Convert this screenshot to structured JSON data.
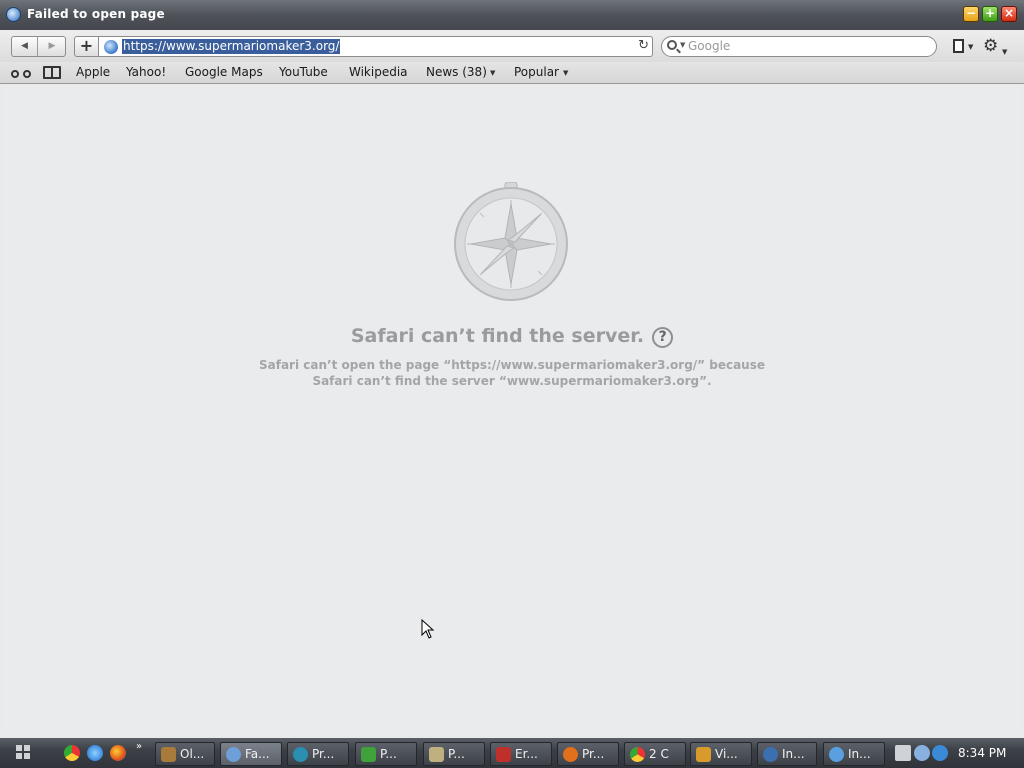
{
  "window": {
    "title": "Failed to open page"
  },
  "toolbar": {
    "back": "◀",
    "forward": "▶",
    "add_bookmark": "+",
    "url": "https://www.supermariomaker3.org/",
    "reload": "↻",
    "search_placeholder": "Google"
  },
  "bookmarks": [
    "Apple",
    "Yahoo!",
    "Google Maps",
    "YouTube",
    "Wikipedia",
    "News (38)",
    "Popular"
  ],
  "error": {
    "heading": "Safari can’t find the server.",
    "help": "?",
    "body_line1": "Safari can’t open the page “https://www.supermariomaker3.org/” because",
    "body_line2": "Safari can’t find the server “www.supermariomaker3.org”."
  },
  "taskbar": {
    "tasks": [
      "Ol...",
      "Fa...",
      "Pr...",
      "P...",
      "P...",
      "Er...",
      "Pr...",
      "2 C",
      "Vi...",
      "In...",
      "In..."
    ],
    "clock": "8:34 PM"
  },
  "colors": {
    "titlebar": "#4e5259",
    "content_bg": "#eaebec",
    "url_highlight": "#3a5e9c",
    "taskbar": "#3c4047"
  }
}
